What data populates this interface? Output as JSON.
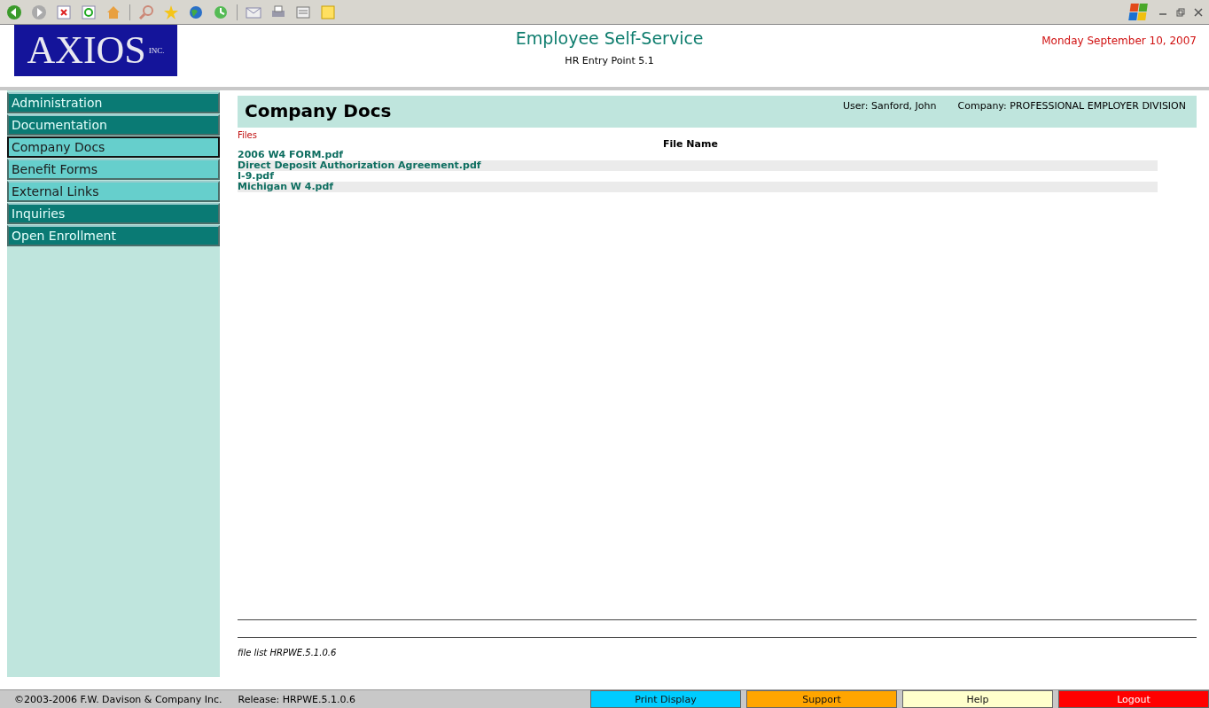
{
  "logo": {
    "name": "AXIOS",
    "suffix": "INC."
  },
  "header": {
    "title": "Employee Self-Service",
    "subtitle": "HR Entry Point 5.1",
    "date": "Monday September 10, 2007"
  },
  "sidebar": {
    "items": [
      {
        "label": "Administration",
        "kind": "group",
        "selected": false
      },
      {
        "label": "Documentation",
        "kind": "group",
        "selected": false
      },
      {
        "label": "Company Docs",
        "kind": "item",
        "selected": true
      },
      {
        "label": "Benefit Forms",
        "kind": "item",
        "selected": false
      },
      {
        "label": "External Links",
        "kind": "item",
        "selected": false
      },
      {
        "label": "Inquiries",
        "kind": "group",
        "selected": false
      },
      {
        "label": "Open Enrollment",
        "kind": "group",
        "selected": false
      }
    ]
  },
  "page": {
    "title": "Company Docs",
    "user": "User: Sanford, John",
    "company": "Company: PROFESSIONAL EMPLOYER DIVISION",
    "section": "Files",
    "column": "File Name",
    "files": [
      "2006 W4 FORM.pdf",
      "Direct Deposit Authorization Agreement.pdf",
      "I-9.pdf",
      "Michigan W 4.pdf"
    ],
    "footnote": "file list HRPWE.5.1.0.6"
  },
  "status_bar": {
    "copyright": "©2003-2006 F.W. Davison & Company Inc.",
    "release": "Release: HRPWE.5.1.0.6",
    "buttons": [
      {
        "label": "Print Display",
        "color": "#00ccff"
      },
      {
        "label": "Support",
        "color": "#ffa500"
      },
      {
        "label": "Help",
        "color": "#ffffcc"
      },
      {
        "label": "Logout",
        "color": "#ff0000"
      }
    ]
  }
}
